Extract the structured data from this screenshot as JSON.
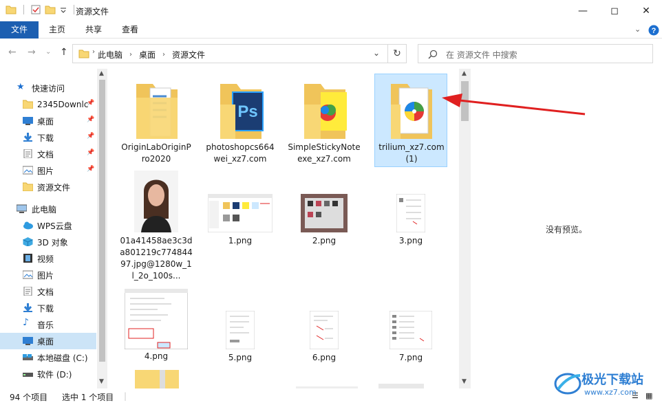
{
  "window": {
    "title": "资源文件",
    "minimize_icon": "minimize-icon",
    "maximize_icon": "maximize-icon",
    "close_icon": "close-icon"
  },
  "ribbon": {
    "tabs": [
      "文件",
      "主页",
      "共享",
      "查看"
    ],
    "help_icon": "help-icon"
  },
  "address": {
    "crumbs": [
      "此电脑",
      "桌面",
      "资源文件"
    ],
    "search_placeholder": "在 资源文件 中搜索"
  },
  "nav": {
    "quick_access": "快速访问",
    "items": [
      {
        "label": "2345Downlc",
        "pinned": true
      },
      {
        "label": "桌面",
        "pinned": true
      },
      {
        "label": "下载",
        "pinned": true
      },
      {
        "label": "文档",
        "pinned": true
      },
      {
        "label": "图片",
        "pinned": true
      },
      {
        "label": "资源文件",
        "pinned": false
      }
    ],
    "this_pc": "此电脑",
    "pc_items": [
      "WPS云盘",
      "3D 对象",
      "视频",
      "图片",
      "文档",
      "下载",
      "音乐",
      "桌面",
      "本地磁盘 (C:)",
      "软件 (D:)"
    ]
  },
  "files": [
    {
      "name": "OriginLabOriginPro2020"
    },
    {
      "name": "photoshopcs664wei_xz7.com"
    },
    {
      "name": "SimpleStickyNoteexe_xz7.com"
    },
    {
      "name": "trilium_xz7.com (1)"
    },
    {
      "name": "01a41458ae3c3da801219c77484497.jpg@1280w_1l_2o_100s..."
    },
    {
      "name": "1.png"
    },
    {
      "name": "2.png"
    },
    {
      "name": "3.png"
    },
    {
      "name": "4.png"
    },
    {
      "name": "5.png"
    },
    {
      "name": "6.png"
    },
    {
      "name": "7.png"
    }
  ],
  "preview_text": "没有预览。",
  "status": {
    "count": "94 个项目",
    "selected": "选中 1 个项目"
  },
  "watermark": {
    "brand": "极光下载站",
    "url": "www.xz7.com"
  },
  "colors": {
    "accent": "#1c5fb1",
    "selection": "#cce8ff",
    "arrow": "#e02020"
  }
}
